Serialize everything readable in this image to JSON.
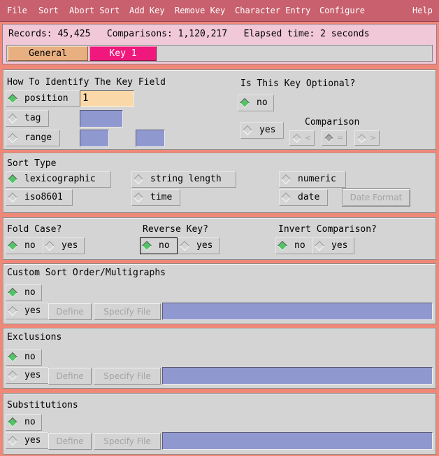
{
  "menu": {
    "file": "File",
    "sort": "Sort",
    "abort_sort": "Abort Sort",
    "add_key": "Add Key",
    "remove_key": "Remove Key",
    "character_entry": "Character Entry",
    "configure": "Configure",
    "help": "Help"
  },
  "status": {
    "records": "Records: 45,425",
    "comparisons": "Comparisons: 1,120,217",
    "elapsed": "Elapsed time: 2 seconds"
  },
  "tabs": {
    "general": "General",
    "key1": "Key 1"
  },
  "identify": {
    "title": "How To Identify The Key Field",
    "position": "position",
    "position_value": "1",
    "tag": "tag",
    "range": "range"
  },
  "optional": {
    "title": "Is This Key Optional?",
    "no": "no",
    "yes": "yes",
    "comparison_label": "Comparison",
    "cmp_lt": "<",
    "cmp_eq": "=",
    "cmp_gt": ">"
  },
  "sort_type": {
    "title": "Sort Type",
    "lexicographic": "lexicographic",
    "string_length": "string length",
    "numeric": "numeric",
    "iso8601": "iso8601",
    "time": "time",
    "date": "date",
    "date_format": "Date Format"
  },
  "fold_case": {
    "title": "Fold Case?",
    "no": "no",
    "yes": "yes"
  },
  "reverse_key": {
    "title": "Reverse Key?",
    "no": "no",
    "yes": "yes"
  },
  "invert": {
    "title": "Invert Comparison?",
    "no": "no",
    "yes": "yes"
  },
  "custom": {
    "title": "Custom Sort Order/Multigraphs",
    "no": "no",
    "yes": "yes",
    "define": "Define",
    "specify_file": "Specify File"
  },
  "exclusions": {
    "title": "Exclusions",
    "no": "no",
    "yes": "yes",
    "define": "Define",
    "specify_file": "Specify File"
  },
  "substitutions": {
    "title": "Substitutions",
    "no": "no",
    "yes": "yes",
    "define": "Define",
    "specify_file": "Specify File"
  },
  "colors": {
    "menubar": "#c8606e",
    "background": "#f08878",
    "status": "#f0c8d8",
    "tab_general": "#e8b080",
    "tab_key1": "#f0187c",
    "field": "#9098d0",
    "field_active": "#fad8a8",
    "radio_selected": "#52c466"
  }
}
